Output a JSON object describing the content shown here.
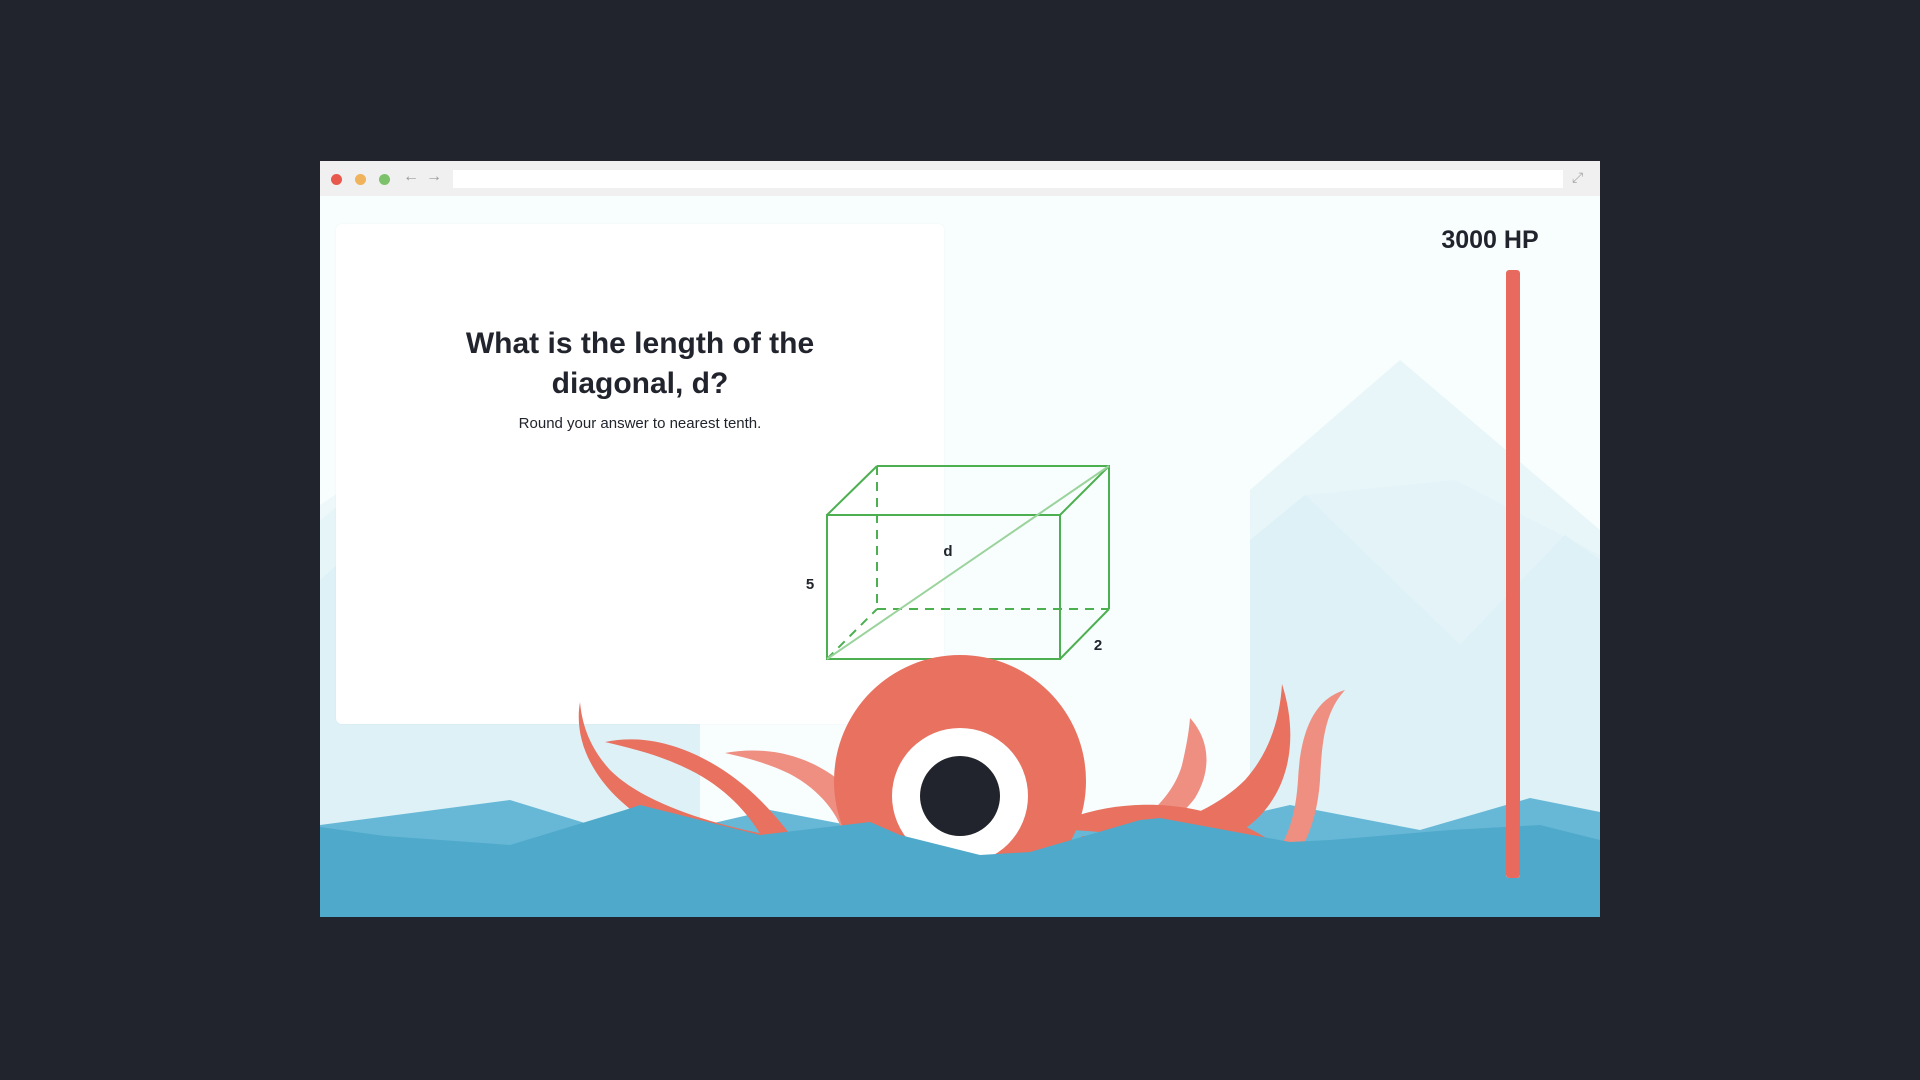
{
  "question": {
    "title_line1": "What is the length of the",
    "title_line2": "diagonal, d?",
    "instruction": "Round your answer to nearest tenth."
  },
  "diagram": {
    "label_diagonal": "d",
    "label_height": "5",
    "label_depth": "2",
    "line_color": "#4caf50"
  },
  "player": {
    "hp_text": "3000 HP",
    "hp_fraction": 1.0,
    "bar_color": "#e8695e"
  },
  "window": {
    "controls": [
      "close-dot",
      "minimize-dot",
      "maximize-dot"
    ],
    "back_icon": "arrow-left-icon",
    "forward_icon": "arrow-right-icon",
    "expand_icon": "expand-icon"
  },
  "colors": {
    "monster": "#e8715f",
    "water": "#4fa9cb",
    "background": "#21242d"
  }
}
